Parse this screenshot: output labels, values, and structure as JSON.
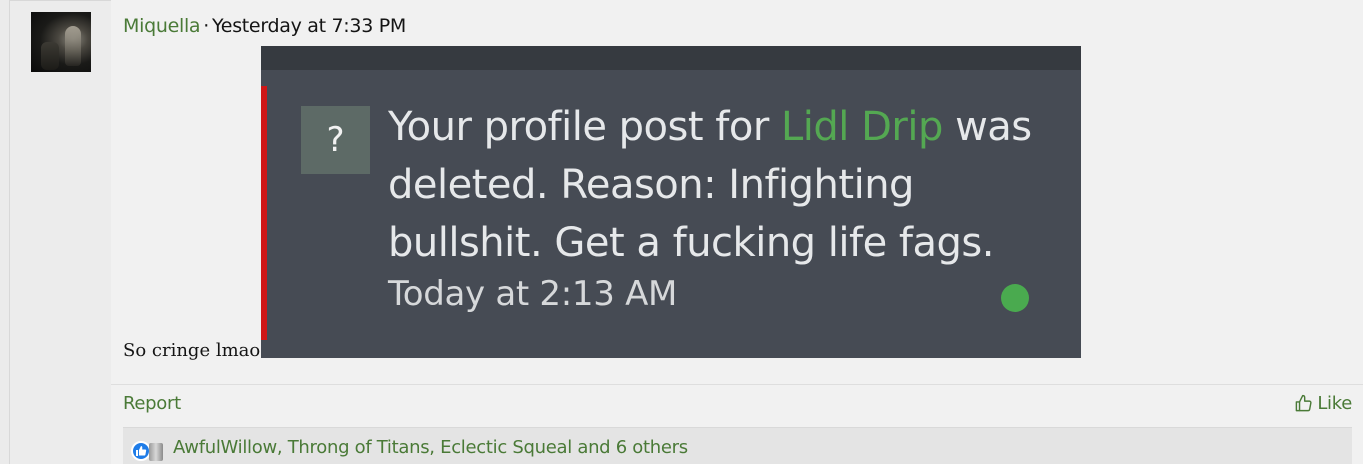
{
  "post": {
    "author": "Miquella",
    "separator": "·",
    "timestamp": "Yesterday at 7:33 PM",
    "body_text": "So cringe lmao"
  },
  "embed_image": {
    "question_mark": "?",
    "message_prefix": "Your profile post for ",
    "message_link": "Lidl Drip",
    "message_suffix": " was deleted. Reason: Infighting bullshit. Get a fucking life fags.",
    "time": "Today at 2:13 AM",
    "colors": {
      "background": "#464b54",
      "accent_bar": "#d01616",
      "link": "#54a852",
      "status_dot": "#4aaa4f"
    }
  },
  "actions": {
    "report_label": "Report",
    "like_label": "Like"
  },
  "reactions": {
    "names_text": "AwfulWillow, Throng of Titans, Eclectic Squeal and 6 others",
    "icons": [
      "like-reaction-icon",
      "jar-reaction-icon"
    ]
  },
  "colors": {
    "link_green": "#4a7a37",
    "text": "#141414",
    "panel": "#f1f1f1"
  }
}
